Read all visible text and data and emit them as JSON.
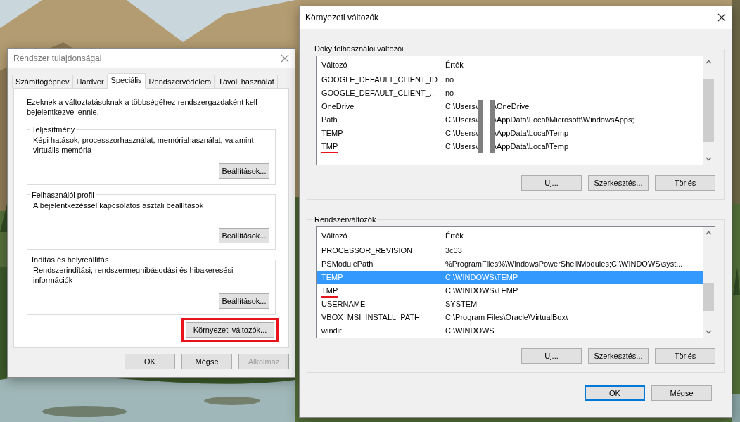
{
  "system_properties": {
    "title": "Rendszer tulajdonságai",
    "tabs": [
      {
        "label": "Számítógépnév",
        "selected": false
      },
      {
        "label": "Hardver",
        "selected": false
      },
      {
        "label": "Speciális",
        "selected": true
      },
      {
        "label": "Rendszervédelem",
        "selected": false
      },
      {
        "label": "Távoli használat",
        "selected": false
      }
    ],
    "intro": "Ezeknek a változtatásoknak a többségéhez rendszergazdaként kell bejelentkezve lennie.",
    "groups": [
      {
        "title": "Teljesítmény",
        "description": "Képi hatások, processzorhasználat, memóriahasználat, valamint virtuális memória",
        "button": "Beállítások..."
      },
      {
        "title": "Felhasználói profil",
        "description": "A bejelentkezéssel kapcsolatos asztali beállítások",
        "button": "Beállítások..."
      },
      {
        "title": "Indítás és helyreállítás",
        "description": "Rendszerindítási, rendszermeghibásodási és hibakeresési információk",
        "button": "Beállítások..."
      }
    ],
    "env_button": {
      "label": "Környezeti változók...",
      "highlighted": true
    },
    "buttons": [
      {
        "label": "OK",
        "disabled": false
      },
      {
        "label": "Mégse",
        "disabled": false
      },
      {
        "label": "Alkalmaz",
        "disabled": true
      }
    ]
  },
  "environment_variables": {
    "title": "Környezeti változók",
    "sections": [
      {
        "title": "Doky felhasználói változói",
        "columns": [
          "Változó",
          "Érték"
        ],
        "rows": [
          {
            "name": "GOOGLE_DEFAULT_CLIENT_ID",
            "value": "no",
            "selected": false,
            "underlined": false,
            "redacted": false
          },
          {
            "name": "GOOGLE_DEFAULT_CLIENT_...",
            "value": "no",
            "selected": false,
            "underlined": false,
            "redacted": false
          },
          {
            "name": "OneDrive",
            "value": "C:\\Users\\",
            "value_tail": "\\OneDrive",
            "selected": false,
            "underlined": false,
            "redacted": true
          },
          {
            "name": "Path",
            "value": "C:\\Users\\",
            "value_tail": "\\AppData\\Local\\Microsoft\\WindowsApps;",
            "selected": false,
            "underlined": false,
            "redacted": true
          },
          {
            "name": "TEMP",
            "value": "C:\\Users\\",
            "value_tail": "\\AppData\\Local\\Temp",
            "selected": false,
            "underlined": false,
            "redacted": true
          },
          {
            "name": "TMP",
            "value": "C:\\Users\\",
            "value_tail": "\\AppData\\Local\\Temp",
            "selected": false,
            "underlined": true,
            "redacted": true
          }
        ],
        "buttons": [
          "Új...",
          "Szerkesztés...",
          "Törlés"
        ]
      },
      {
        "title": "Rendszerváltozók",
        "columns": [
          "Változó",
          "Érték"
        ],
        "rows": [
          {
            "name": "PROCESSOR_REVISION",
            "value": "3c03",
            "selected": false,
            "underlined": false,
            "redacted": false
          },
          {
            "name": "PSModulePath",
            "value": "%ProgramFiles%\\WindowsPowerShell\\Modules;C:\\WINDOWS\\syst...",
            "selected": false,
            "underlined": false,
            "redacted": false
          },
          {
            "name": "TEMP",
            "value": "C:\\WINDOWS\\TEMP",
            "selected": true,
            "underlined": false,
            "redacted": false
          },
          {
            "name": "TMP",
            "value": "C:\\WINDOWS\\TEMP",
            "selected": false,
            "underlined": true,
            "redacted": false
          },
          {
            "name": "USERNAME",
            "value": "SYSTEM",
            "selected": false,
            "underlined": false,
            "redacted": false
          },
          {
            "name": "VBOX_MSI_INSTALL_PATH",
            "value": "C:\\Program Files\\Oracle\\VirtualBox\\",
            "selected": false,
            "underlined": false,
            "redacted": false
          },
          {
            "name": "windir",
            "value": "C:\\WINDOWS",
            "selected": false,
            "underlined": false,
            "redacted": false
          }
        ],
        "buttons": [
          "Új...",
          "Szerkesztés...",
          "Törlés"
        ]
      }
    ],
    "buttons": [
      {
        "label": "OK",
        "default": true
      },
      {
        "label": "Mégse",
        "default": false
      }
    ]
  }
}
